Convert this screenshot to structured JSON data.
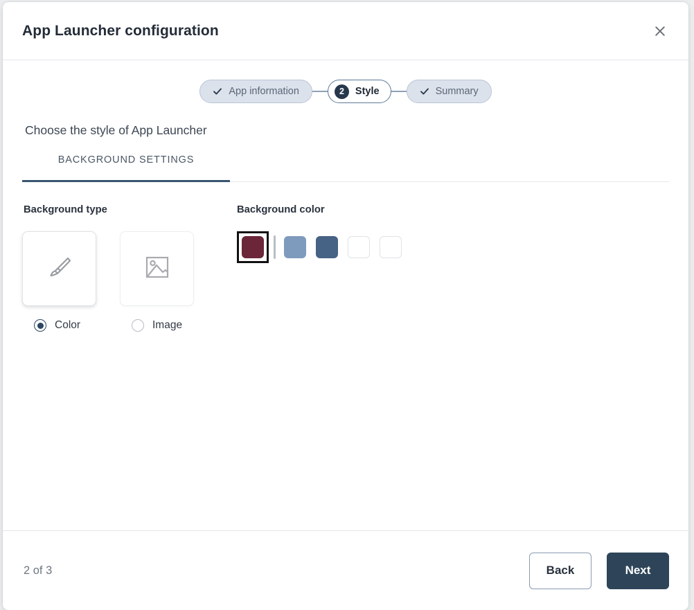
{
  "dialog": {
    "title": "App Launcher configuration",
    "close_icon": "close-icon"
  },
  "stepper": {
    "steps": [
      {
        "label": "App information",
        "state": "done",
        "icon": "check-icon"
      },
      {
        "label": "Style",
        "state": "current",
        "badge": "2"
      },
      {
        "label": "Summary",
        "state": "done",
        "icon": "check-icon"
      }
    ]
  },
  "main": {
    "heading": "Choose the style of App Launcher",
    "tabs": [
      {
        "label": "BACKGROUND SETTINGS",
        "active": true
      }
    ],
    "background_type": {
      "label": "Background type",
      "options": [
        {
          "label": "Color",
          "icon": "paintbrush-icon",
          "selected": true
        },
        {
          "label": "Image",
          "icon": "image-icon",
          "selected": false
        }
      ]
    },
    "background_color": {
      "label": "Background color",
      "swatches": [
        {
          "name": "swatch-maroon",
          "color": "#6b2639",
          "selected": true,
          "empty": false
        },
        {
          "name": "swatch-light-blue",
          "color": "#7e9bbd",
          "selected": false,
          "empty": false
        },
        {
          "name": "swatch-dark-blue",
          "color": "#466284",
          "selected": false,
          "empty": false
        },
        {
          "name": "swatch-empty-1",
          "color": "#ffffff",
          "selected": false,
          "empty": true
        },
        {
          "name": "swatch-empty-2",
          "color": "#ffffff",
          "selected": false,
          "empty": true
        }
      ]
    }
  },
  "footer": {
    "page_count": "2 of 3",
    "back_label": "Back",
    "next_label": "Next"
  },
  "theme": {
    "accent": "#2e4559",
    "step_done_bg": "#dbe2ec",
    "tab_underline": "#3a5570"
  }
}
